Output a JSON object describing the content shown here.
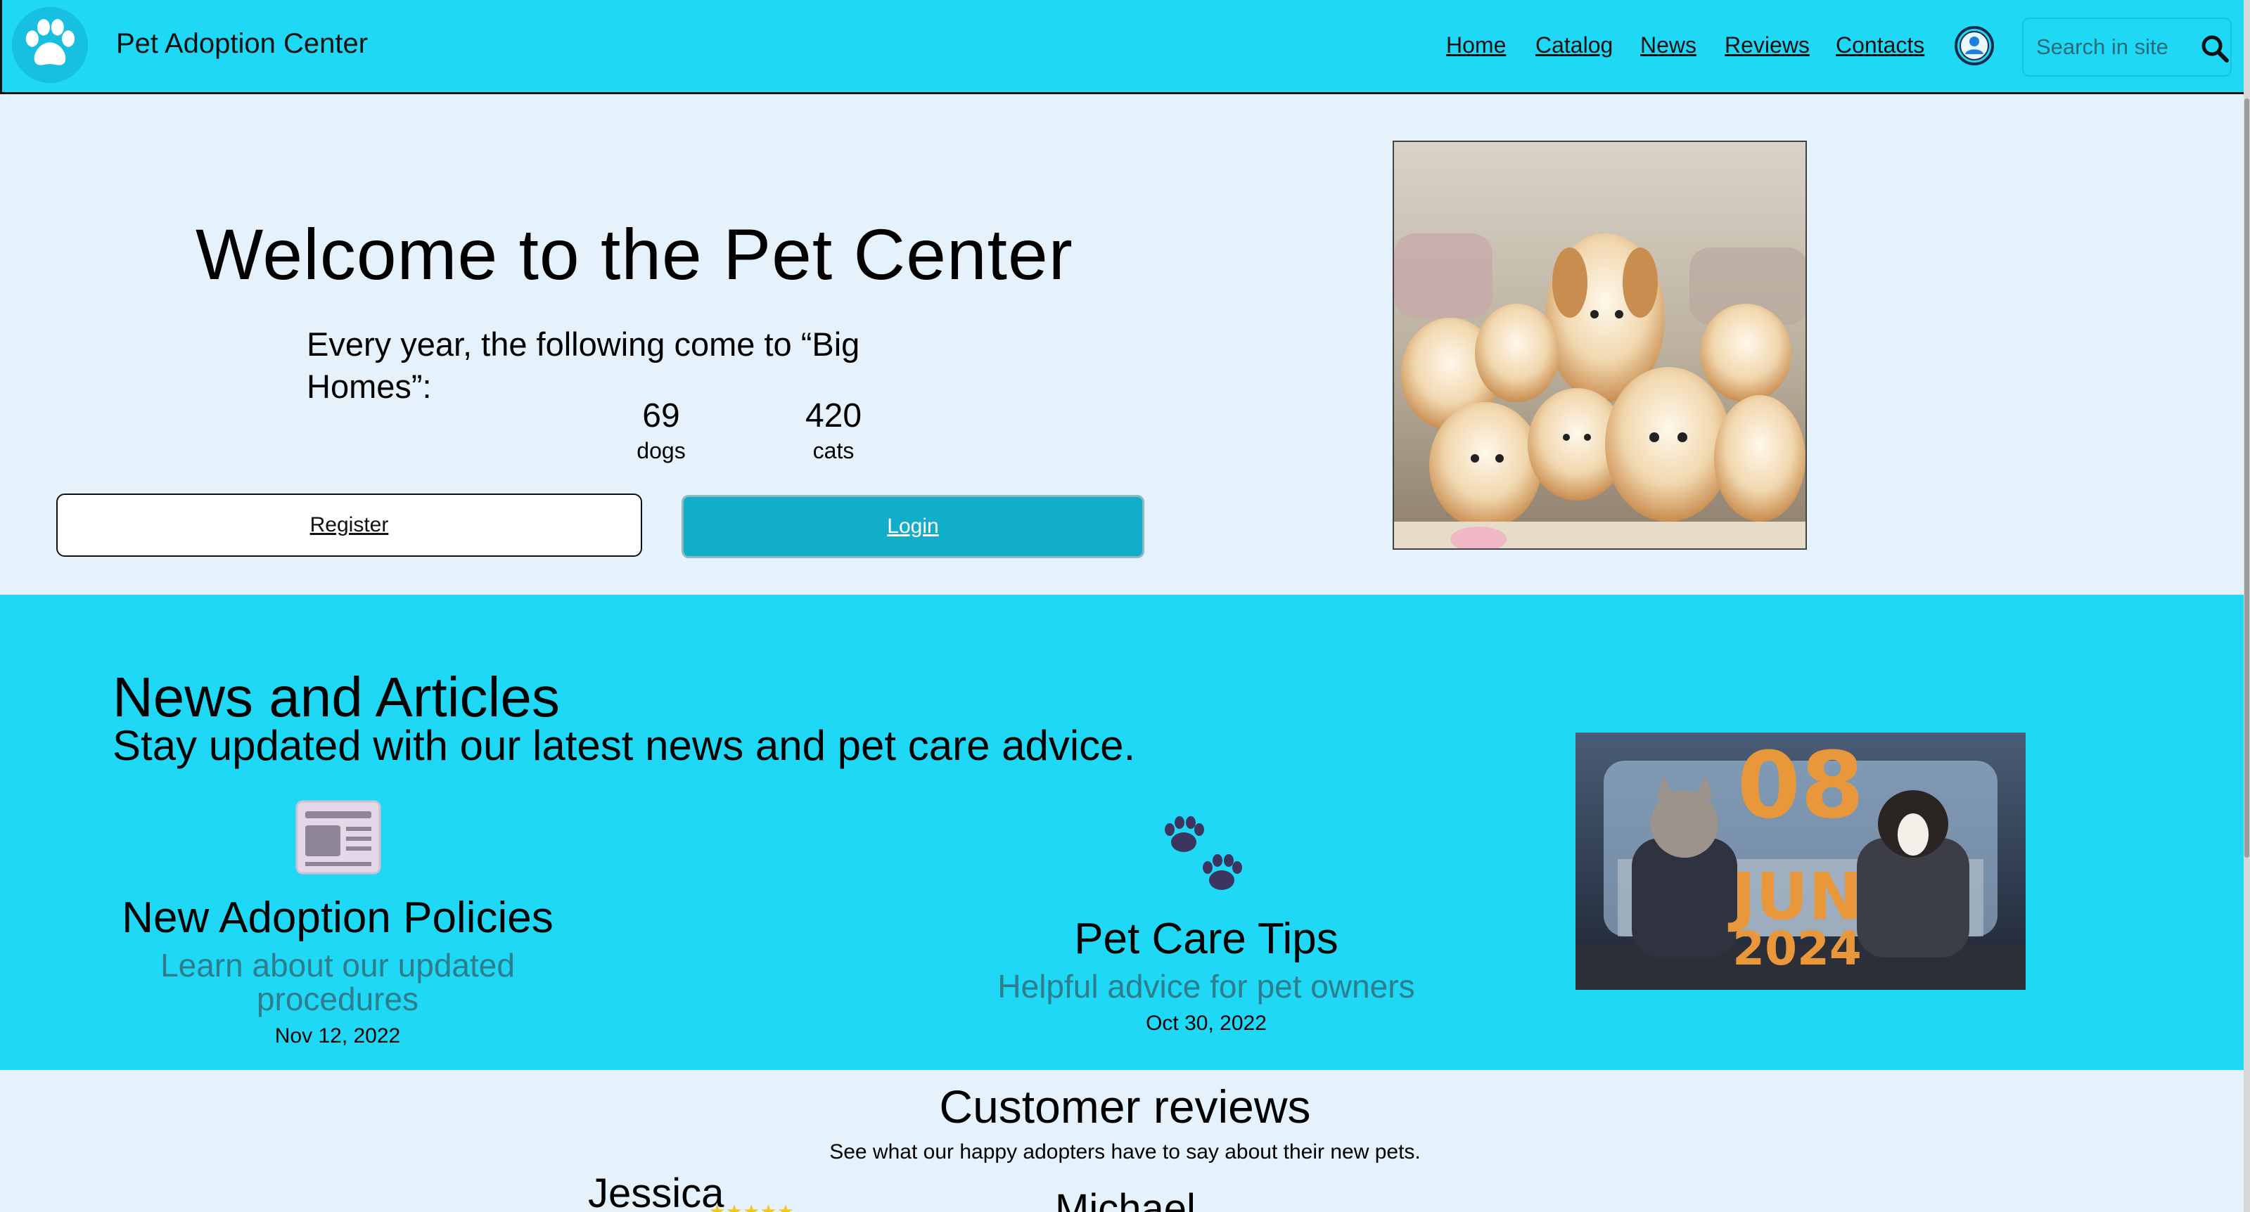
{
  "header": {
    "app_title": "Pet Adoption Center",
    "nav": [
      "Home",
      "Catalog",
      "News",
      "Reviews",
      "Contacts"
    ],
    "search_placeholder": "Search in site"
  },
  "hero": {
    "title": "Welcome to the Pet Center",
    "subtitle": "Every year, the following come to “Big Homes”:",
    "stats": [
      {
        "value": "69",
        "label": "dogs"
      },
      {
        "value": "420",
        "label": "cats"
      }
    ],
    "register_label": "Register",
    "login_label": "Login"
  },
  "news": {
    "title": "News and Articles",
    "subtitle": "Stay updated with our latest news and pet care advice.",
    "articles": [
      {
        "icon": "newspaper-icon",
        "title": "New Adoption Policies",
        "desc": "Learn about our updated procedures",
        "date": "Nov 12, 2022"
      },
      {
        "icon": "paw-prints-icon",
        "title": "Pet Care Tips",
        "desc": "Helpful advice for pet owners",
        "date": "Oct 30, 2022"
      }
    ],
    "image_text": {
      "day": "08",
      "month": "JUN",
      "year": "2024"
    }
  },
  "reviews": {
    "title": "Customer reviews",
    "subtitle": "See what our happy adopters have to say about their new pets.",
    "reviewers": [
      "Jessica",
      "Michael"
    ],
    "stars": "★★★★★"
  },
  "colors": {
    "header_bg": "#1fd8f5",
    "page_bg": "#e6f2fb",
    "login_bg": "#12adc9",
    "accent_text": "#2e7d8c"
  }
}
